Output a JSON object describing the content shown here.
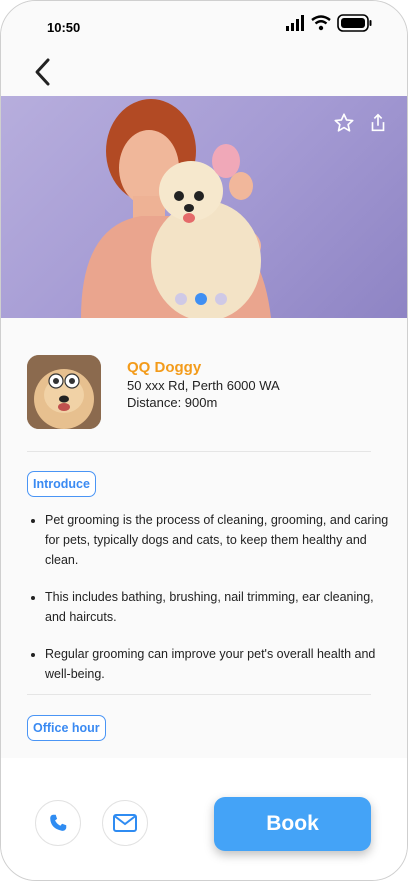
{
  "status_bar": {
    "time": "10:50"
  },
  "hero": {
    "slide_count": 3,
    "active_slide": 2
  },
  "vendor": {
    "name": "QQ Doggy",
    "address": "50 xxx Rd, Perth 6000 WA",
    "distance": "Distance: 900m"
  },
  "introduce": {
    "label": "Introduce",
    "bullets": [
      "Pet grooming is the process of cleaning, grooming, and caring for pets, typically dogs and cats, to keep them healthy and clean.",
      "This includes bathing, brushing, nail trimming, ear cleaning, and haircuts.",
      "Regular grooming can improve your pet's overall health and well-being."
    ]
  },
  "office_hour": {
    "label": "Office hour"
  },
  "footer": {
    "book_label": "Book"
  },
  "colors": {
    "accent": "#44a3f7",
    "vendor_name": "#f39b1a"
  }
}
